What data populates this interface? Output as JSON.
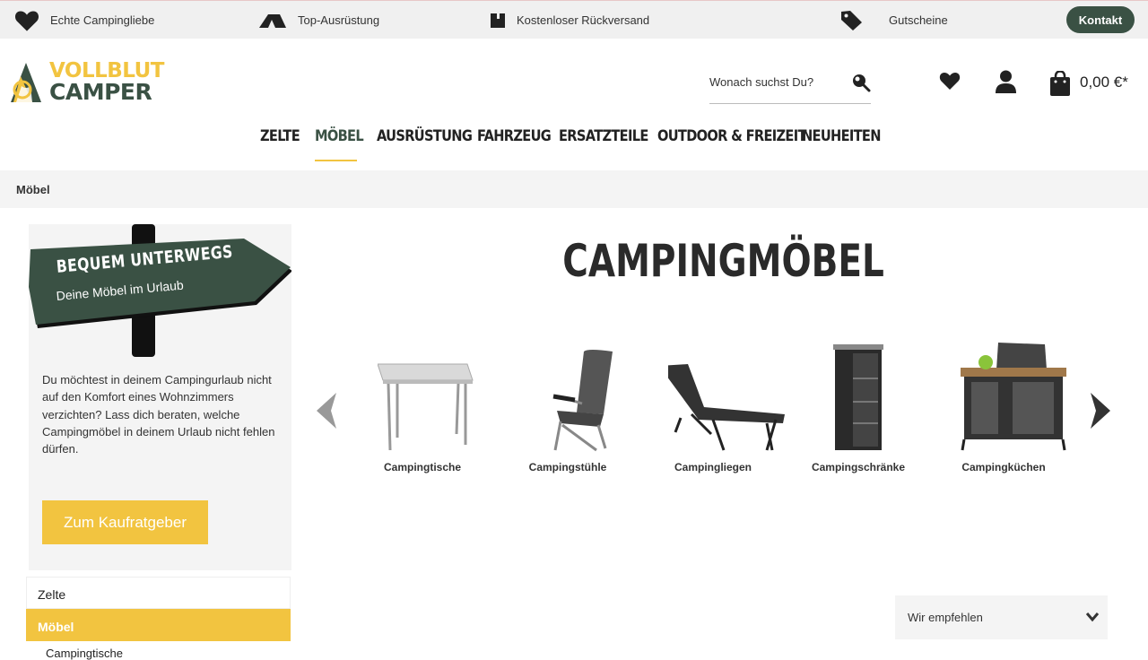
{
  "topbar": {
    "items": [
      {
        "icon": "heart-icon",
        "label": "Echte Campingliebe"
      },
      {
        "icon": "tent-icon",
        "label": "Top-Ausrüstung"
      },
      {
        "icon": "box-icon",
        "label": "Kostenloser Rückversand"
      },
      {
        "icon": "tag-icon",
        "label": "Gutscheine"
      }
    ],
    "contact_label": "Kontakt"
  },
  "header": {
    "logo_line1": "VOLLBLUT",
    "logo_line2": "CAMPER",
    "search_placeholder": "Wonach suchst Du?",
    "cart_total": "0,00 €*"
  },
  "nav": {
    "items": [
      "ZELTE",
      "MÖBEL",
      "AUSRÜSTUNG",
      "FAHRZEUG",
      "ERSATZTEILE",
      "OUTDOOR & FREIZEIT",
      "NEUHEITEN"
    ],
    "active": "MÖBEL"
  },
  "breadcrumb": "Möbel",
  "teaser": {
    "sign_title": "BEQUEM UNTERWEGS",
    "sign_subtitle": "Deine Möbel im Urlaub",
    "text": "Du möchtest in deinem Campingurlaub nicht auf den Komfort eines Wohnzimmers verzichten? Lass dich beraten, welche Campingmöbel in deinem Urlaub nicht fehlen dürfen.",
    "button": "Zum Kaufratgeber"
  },
  "categories": [
    {
      "label": "Zelte",
      "active": false
    },
    {
      "label": "Möbel",
      "active": true
    },
    {
      "label": "Campingtische",
      "sub": true
    }
  ],
  "main": {
    "title": "CAMPINGMÖBEL",
    "tiles": [
      "Campingtische",
      "Campingstühle",
      "Campingliegen",
      "Campingschränke",
      "Campingküchen"
    ],
    "sort_label": "Wir empfehlen"
  },
  "colors": {
    "brand_green": "#3a5144",
    "brand_yellow": "#f2c440",
    "topbar_bg": "#f0f0f0"
  }
}
